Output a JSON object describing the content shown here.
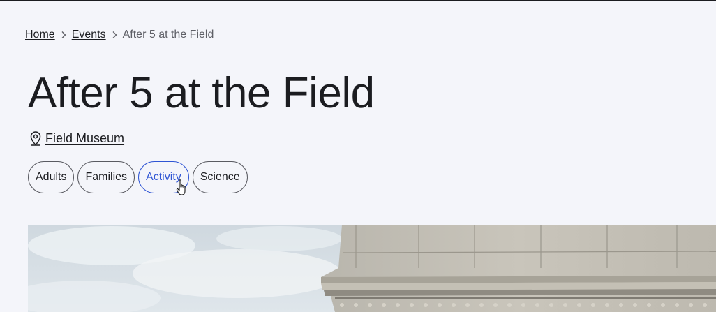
{
  "breadcrumb": {
    "items": [
      {
        "label": "Home"
      },
      {
        "label": "Events"
      }
    ],
    "current": "After 5 at the Field"
  },
  "event": {
    "title": "After 5 at the Field",
    "location": "Field Museum"
  },
  "tags": [
    {
      "label": "Adults",
      "active": false
    },
    {
      "label": "Families",
      "active": false
    },
    {
      "label": "Activity",
      "active": true
    },
    {
      "label": "Science",
      "active": false
    }
  ],
  "colors": {
    "background": "#f4f5fa",
    "text": "#1b1c20",
    "accent": "#2f55d4",
    "muted": "#5e5f66"
  },
  "icons": {
    "breadcrumb_separator": "chevron-right-icon",
    "location": "map-pin-icon",
    "cursor": "hand-pointer-icon"
  }
}
